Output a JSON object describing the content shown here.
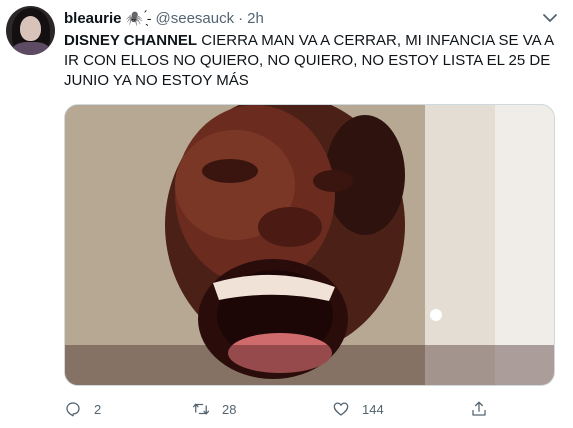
{
  "author": {
    "display_name": "bleaurie",
    "name_emoji": "🕷️ ̖́-",
    "handle": "@seesauck",
    "separator": "·",
    "time": "2h"
  },
  "tweet": {
    "bold_text": "DISNEY CHANNEL",
    "text": " CIERRA MAN VA A CERRAR, MI INFANCIA SE VA A IR CON ELLOS NO QUIERO, NO QUIERO, NO ESTOY LISTA EL 25 DE JUNIO YA NO ESTOY MÁS"
  },
  "actions": {
    "reply_count": "2",
    "retweet_count": "28",
    "like_count": "144"
  },
  "colors": {
    "text": "#0f1419",
    "secondary": "#536471",
    "border": "#cfd9de"
  },
  "icons": [
    "more-caret-icon",
    "reply-icon",
    "retweet-icon",
    "like-icon",
    "share-icon"
  ]
}
